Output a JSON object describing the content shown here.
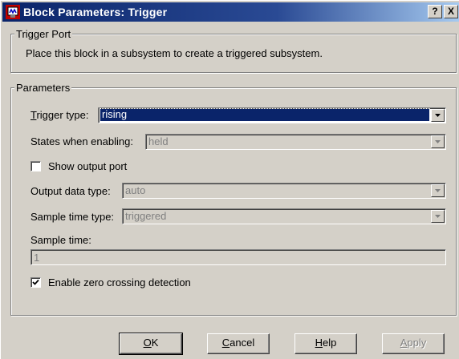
{
  "window": {
    "title": "Block Parameters: Trigger",
    "help_glyph": "?",
    "close_glyph": "X",
    "icon": "simulink-block-icon"
  },
  "trigger_port": {
    "group_title": "Trigger Port",
    "description": "Place this block in a subsystem to create a triggered subsystem."
  },
  "parameters": {
    "group_title": "Parameters",
    "trigger_type": {
      "label_prefix": "T",
      "label_rest": "rigger type:",
      "value": "rising",
      "enabled": true,
      "focused": true
    },
    "states_when_enabling": {
      "label": "States when enabling:",
      "value": "held",
      "enabled": false
    },
    "show_output_port": {
      "label": "Show output port",
      "checked": false
    },
    "output_data_type": {
      "label": "Output data type:",
      "value": "auto",
      "enabled": false
    },
    "sample_time_type": {
      "label": "Sample time type:",
      "value": "triggered",
      "enabled": false
    },
    "sample_time": {
      "label": "Sample time:",
      "value": "1",
      "enabled": false
    },
    "enable_zero_crossing": {
      "label": "Enable zero crossing detection",
      "checked": true
    }
  },
  "buttons": {
    "ok": {
      "mnemonic": "O",
      "rest": "K"
    },
    "cancel": {
      "mnemonic": "C",
      "rest": "ancel"
    },
    "help": {
      "mnemonic": "H",
      "rest": "elp"
    },
    "apply": {
      "mnemonic": "A",
      "rest": "pply",
      "enabled": false
    }
  },
  "colors": {
    "title_gradient_start": "#0a246a",
    "title_gradient_end": "#a6caf0",
    "dialog_face": "#d4d0c8",
    "selection": "#0a246a"
  }
}
